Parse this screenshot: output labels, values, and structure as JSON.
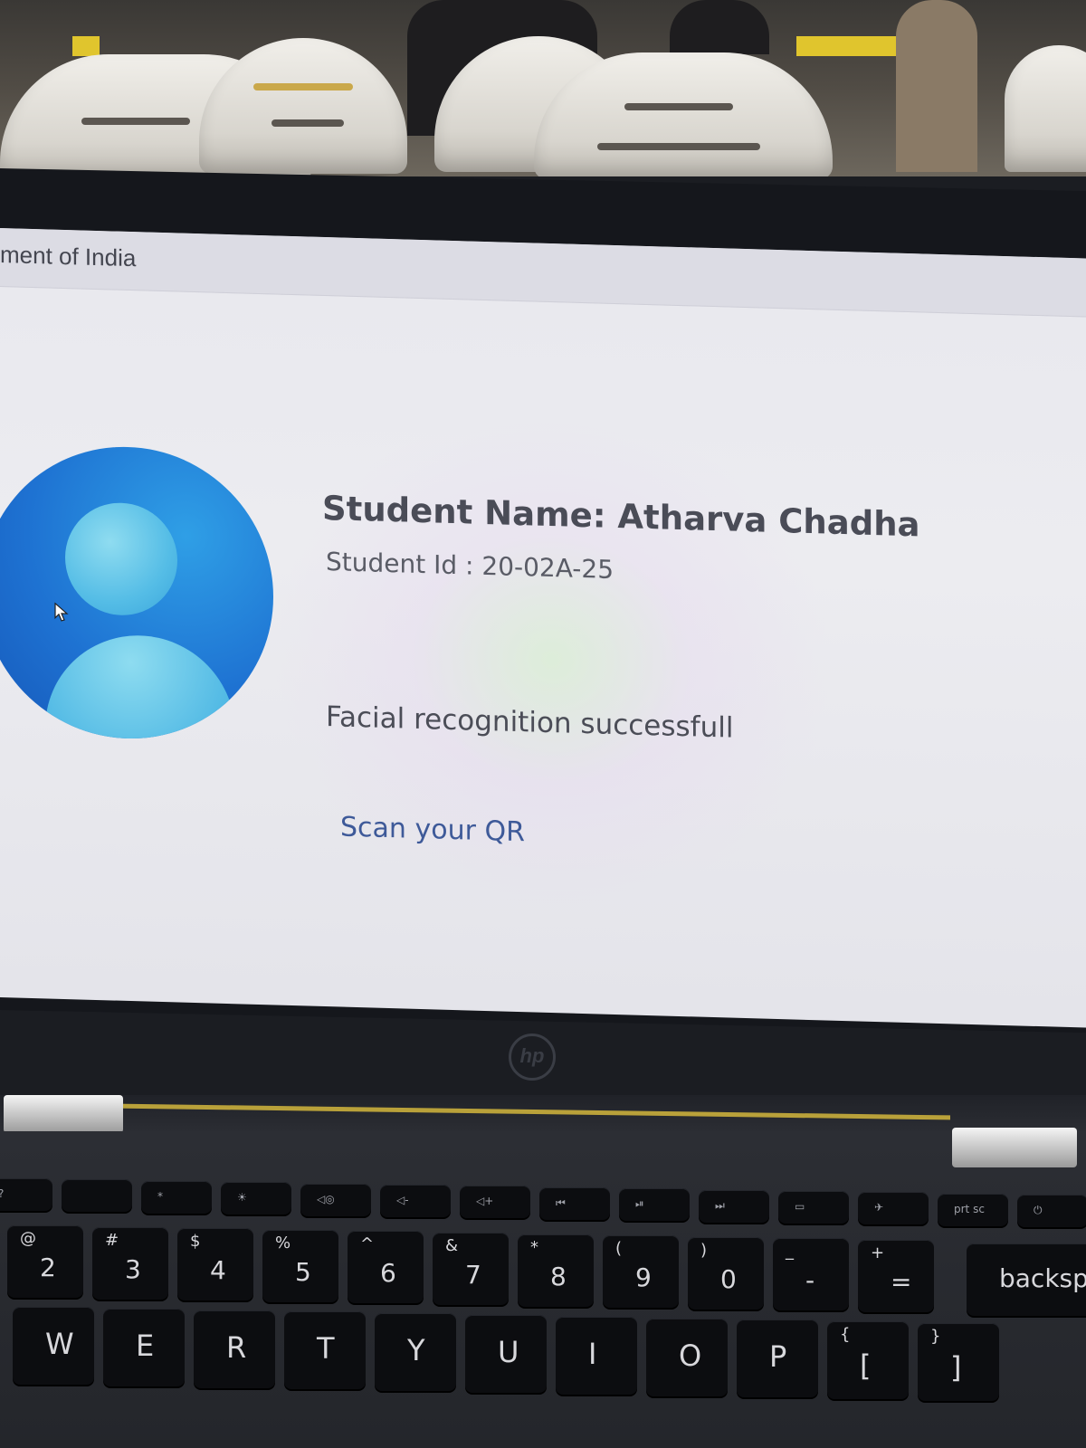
{
  "screen": {
    "topbar_text": "ment of India",
    "student_name": "Student Name: Atharva Chadha",
    "student_id": "Student Id : 20-02A-25",
    "facial_status": "Facial recognition successfull",
    "scan_prompt": "Scan your QR"
  },
  "laptop": {
    "brand": "hp"
  },
  "keyboard": {
    "function_keys": [
      "?",
      "",
      "*",
      "☀",
      "◁◎",
      "◁-",
      "◁+",
      "⏮",
      "⏯",
      "⏭",
      "▭",
      "✈",
      "prt sc",
      "⏻"
    ],
    "number_row": [
      {
        "top": "@",
        "main": "2"
      },
      {
        "top": "#",
        "main": "3"
      },
      {
        "top": "$",
        "main": "4"
      },
      {
        "top": "%",
        "main": "5"
      },
      {
        "top": "^",
        "main": "6"
      },
      {
        "top": "&",
        "main": "7"
      },
      {
        "top": "*",
        "main": "8"
      },
      {
        "top": "(",
        "main": "9"
      },
      {
        "top": ")",
        "main": "0"
      },
      {
        "top": "_",
        "main": "-"
      },
      {
        "top": "+",
        "main": "="
      }
    ],
    "backspace_label": "backspace",
    "letter_row": [
      {
        "main": "W"
      },
      {
        "main": "E"
      },
      {
        "main": "R"
      },
      {
        "main": "T"
      },
      {
        "main": "Y"
      },
      {
        "main": "U"
      },
      {
        "main": "I"
      },
      {
        "main": "O"
      },
      {
        "main": "P"
      },
      {
        "top": "{",
        "main": "["
      },
      {
        "top": "}",
        "main": "]"
      }
    ]
  }
}
